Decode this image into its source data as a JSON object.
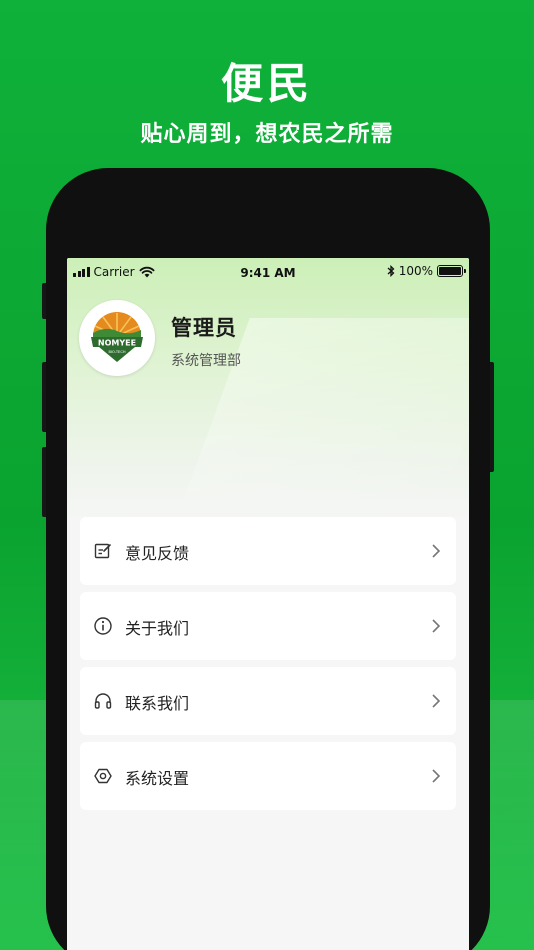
{
  "hero": {
    "title": "便民",
    "subtitle": "贴心周到，想农民之所需"
  },
  "status_bar": {
    "carrier": "Carrier",
    "time": "9:41 AM",
    "battery": "100%"
  },
  "profile": {
    "name": "管理员",
    "department": "系统管理部",
    "logo_text": "NOMYEE",
    "logo_subtext": "BIO-TECH"
  },
  "menu": {
    "items": [
      {
        "label": "意见反馈",
        "icon": "edit-note-icon"
      },
      {
        "label": "关于我们",
        "icon": "info-icon"
      },
      {
        "label": "联系我们",
        "icon": "headset-icon"
      },
      {
        "label": "系统设置",
        "icon": "settings-hex-icon"
      }
    ]
  },
  "colors": {
    "brand_green": "#0fb13a",
    "logo_green": "#2e6b2f",
    "logo_orange": "#e58a1e"
  }
}
